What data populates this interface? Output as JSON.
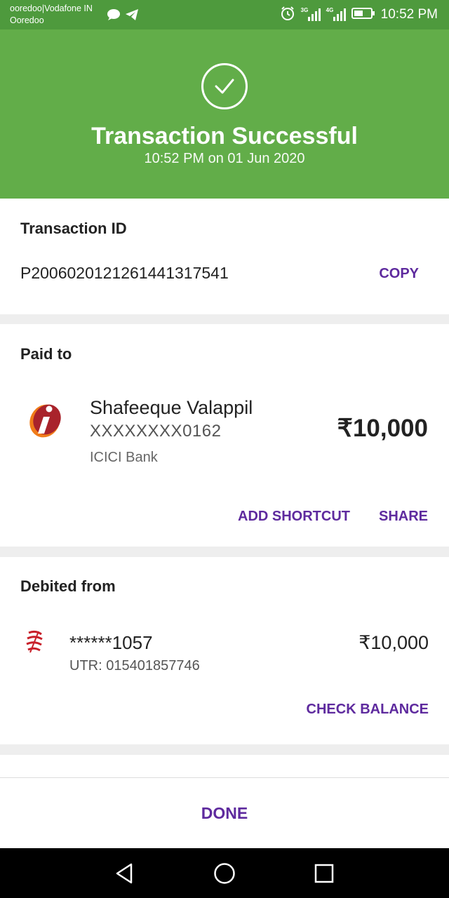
{
  "status_bar": {
    "carrier_line1": "ooredoo|Vodafone IN",
    "carrier_line2": "Ooredoo",
    "network_3g": "3G",
    "network_4g": "4G",
    "time": "10:52 PM"
  },
  "header": {
    "title": "Transaction Successful",
    "datetime": "10:52 PM on 01 Jun 2020",
    "bg_color": "#62ad49"
  },
  "transaction": {
    "label": "Transaction ID",
    "id": "P2006020121261441317541",
    "copy_label": "COPY"
  },
  "paid_to": {
    "label": "Paid to",
    "name": "Shafeeque Valappil",
    "account": "XXXXXXXX0162",
    "bank": "ICICI Bank",
    "amount": "₹10,000",
    "add_shortcut_label": "ADD SHORTCUT",
    "share_label": "SHARE"
  },
  "debited_from": {
    "label": "Debited from",
    "account": "******1057",
    "utr": "UTR: 015401857746",
    "amount": "₹10,000",
    "check_balance_label": "CHECK BALANCE"
  },
  "footer": {
    "done_label": "DONE"
  },
  "colors": {
    "accent": "#5e2a9e",
    "success": "#62ad49",
    "status_bar": "#4e9a3d"
  },
  "icons": [
    "chat-icon",
    "telegram-icon",
    "alarm-icon",
    "signal-icon",
    "battery-icon",
    "check-icon",
    "icici-bank-logo-icon",
    "bank-logo-icon",
    "back-icon",
    "home-icon",
    "recents-icon"
  ]
}
